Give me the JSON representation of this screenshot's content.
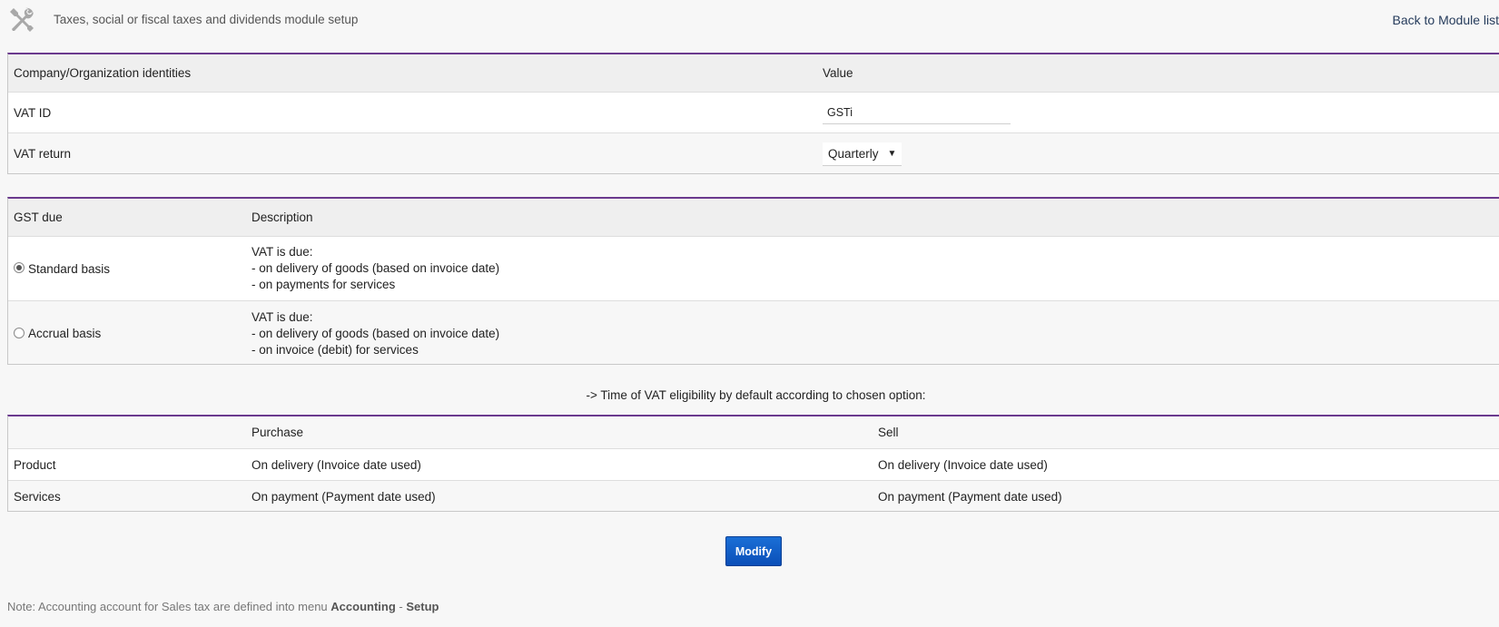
{
  "header": {
    "title": "Taxes, social or fiscal taxes and dividends module setup",
    "back_link": "Back to Module list"
  },
  "identities_table": {
    "col_name": "Company/Organization identities",
    "col_value": "Value",
    "vat_id_label": "VAT ID",
    "vat_id_value": "GSTi",
    "vat_return_label": "VAT return",
    "vat_return_value": "Quarterly"
  },
  "gst_table": {
    "col_due": "GST due",
    "col_desc": "Description",
    "options": [
      {
        "label": "Standard basis",
        "selected": true,
        "desc_line1": "VAT is due:",
        "desc_line2": "- on delivery of goods (based on invoice date)",
        "desc_line3": "- on payments for services"
      },
      {
        "label": "Accrual basis",
        "selected": false,
        "desc_line1": "VAT is due:",
        "desc_line2": "- on delivery of goods (based on invoice date)",
        "desc_line3": "- on invoice (debit) for services"
      }
    ]
  },
  "eligibility_text": "-> Time of VAT eligibility by default according to chosen option:",
  "eligibility_table": {
    "col_purchase": "Purchase",
    "col_sell": "Sell",
    "rows": [
      {
        "label": "Product",
        "purchase": "On delivery (Invoice date used)",
        "sell": "On delivery (Invoice date used)"
      },
      {
        "label": "Services",
        "purchase": "On payment (Payment date used)",
        "sell": "On payment (Payment date used)"
      }
    ]
  },
  "modify_button": "Modify",
  "note": {
    "prefix": "Note: Accounting account for Sales tax are defined into menu ",
    "menu": "Accounting",
    "separator": " - ",
    "submenu": "Setup"
  },
  "colors": {
    "accent": "#6b3a8e",
    "button": "#0b4fb8",
    "link": "#263c5c"
  },
  "icons": {
    "header": "tools-icon"
  }
}
